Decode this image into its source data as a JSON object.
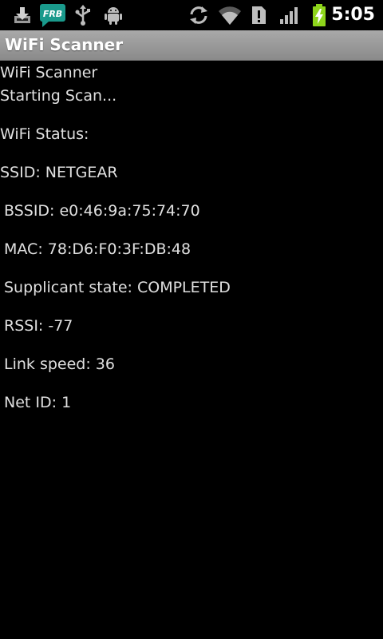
{
  "status_bar": {
    "time": "5:05",
    "icons": [
      "download-icon",
      "fring-app-icon",
      "usb-icon",
      "android-debug-icon",
      "sync-icon",
      "wifi-icon",
      "alert-icon",
      "signal-icon",
      "battery-charging-icon"
    ],
    "notification_badge": "FRB"
  },
  "app": {
    "title": "WiFi Scanner"
  },
  "content": {
    "app_name": "WiFi Scanner",
    "scan_status": "Starting Scan...",
    "wifi_status_label": "WiFi Status:",
    "ssid": "SSID: NETGEAR",
    "bssid": "BSSID: e0:46:9a:75:74:70",
    "mac": "MAC: 78:D6:F0:3F:DB:48",
    "supplicant_state": "Supplicant state: COMPLETED",
    "rssi": "RSSI: -77",
    "link_speed": "Link speed: 36",
    "net_id": "Net ID: 1"
  },
  "colors": {
    "background": "#000000",
    "title_bar": "#9a9a9a",
    "text": "#e0e0e0",
    "badge": "#1a9a8c",
    "battery": "#8ed51b"
  }
}
